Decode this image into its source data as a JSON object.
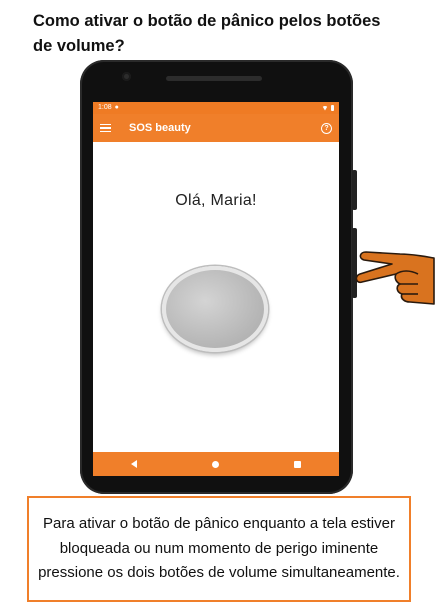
{
  "heading": "Como ativar o botão de pânico pelos botões de volume?",
  "phone": {
    "status_bar": {
      "time": "1:08"
    },
    "app_bar": {
      "title": "SOS beauty",
      "help_label": "?"
    },
    "greeting": "Olá, Maria!",
    "nav_bar": {
      "back_icon": "back-triangle",
      "home_icon": "home-circle",
      "recent_icon": "recent-square"
    }
  },
  "instruction": "Para ativar o botão de pânico enquanto a tela estiver bloqueada ou num momento de perigo iminente pressione os dois botões de volume simultaneamente.",
  "colors": {
    "accent": "#f07f2a",
    "skin": "#d9731f"
  }
}
